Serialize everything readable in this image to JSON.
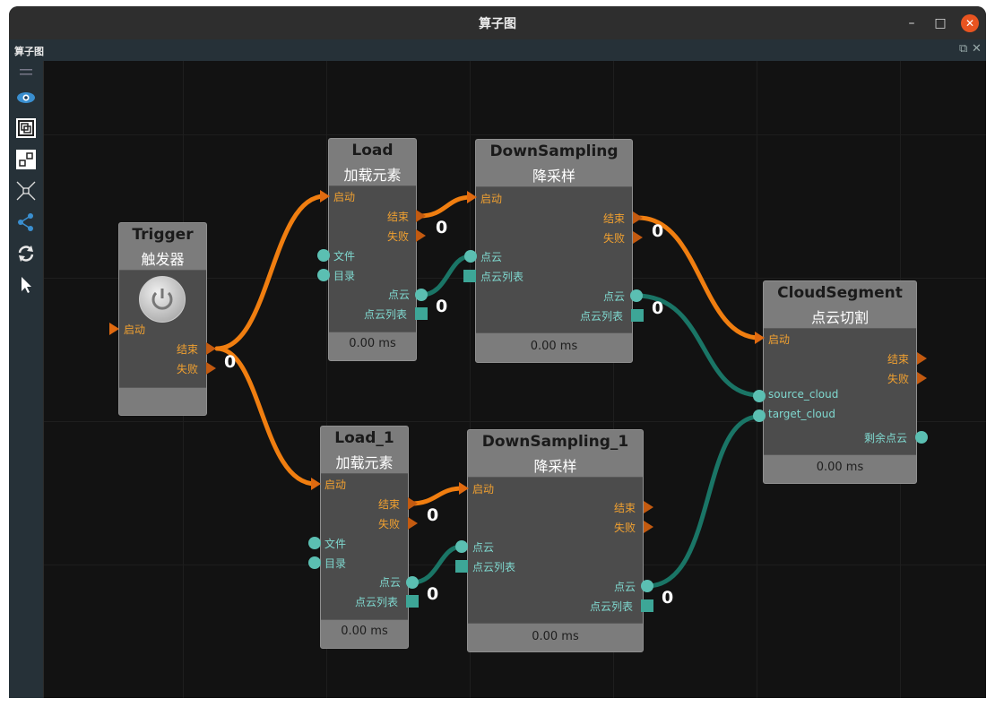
{
  "window": {
    "title": "算子图",
    "minimize_icon": "minimize-icon",
    "maximize_icon": "maximize-icon",
    "close_icon": "close-icon"
  },
  "dock": {
    "title": "算子图"
  },
  "toolbar": {
    "items": [
      "drag-handle-icon",
      "eye-icon",
      "fit-view-icon",
      "arrange-icon",
      "collapse-icon",
      "connect-icon",
      "refresh-icon",
      "pointer-icon"
    ]
  },
  "colors": {
    "control_wire": "#f07e10",
    "data_wire": "#1a7566",
    "canvas": "#121212"
  },
  "nodes": {
    "trigger": {
      "name": "Trigger",
      "sub": "触发器",
      "in_start": "启动",
      "out_end": "结束",
      "out_fail": "失败",
      "count": "0"
    },
    "load": {
      "name": "Load",
      "sub": "加载元素",
      "in_start": "启动",
      "in_file": "文件",
      "in_dir": "目录",
      "out_end": "结束",
      "out_fail": "失败",
      "out_cloud": "点云",
      "out_cloud_list": "点云列表",
      "count_ctl": "0",
      "count_dat": "0",
      "time": "0.00 ms"
    },
    "down": {
      "name": "DownSampling",
      "sub": "降采样",
      "in_start": "启动",
      "in_cloud": "点云",
      "in_cloud_list": "点云列表",
      "out_end": "结束",
      "out_fail": "失败",
      "out_cloud": "点云",
      "out_cloud_list": "点云列表",
      "count_ctl": "0",
      "count_dat": "0",
      "time": "0.00 ms"
    },
    "load1": {
      "name": "Load_1",
      "sub": "加载元素",
      "in_start": "启动",
      "in_file": "文件",
      "in_dir": "目录",
      "out_end": "结束",
      "out_fail": "失败",
      "out_cloud": "点云",
      "out_cloud_list": "点云列表",
      "count_ctl": "0",
      "count_dat": "0",
      "time": "0.00 ms"
    },
    "down1": {
      "name": "DownSampling_1",
      "sub": "降采样",
      "in_start": "启动",
      "in_cloud": "点云",
      "in_cloud_list": "点云列表",
      "out_end": "结束",
      "out_fail": "失败",
      "out_cloud": "点云",
      "out_cloud_list": "点云列表",
      "count_dat": "0",
      "time": "0.00 ms"
    },
    "seg": {
      "name": "CloudSegment",
      "sub": "点云切割",
      "in_start": "启动",
      "in_source": "source_cloud",
      "in_target": "target_cloud",
      "out_end": "结束",
      "out_fail": "失败",
      "out_remain": "剩余点云",
      "time": "0.00 ms"
    }
  }
}
